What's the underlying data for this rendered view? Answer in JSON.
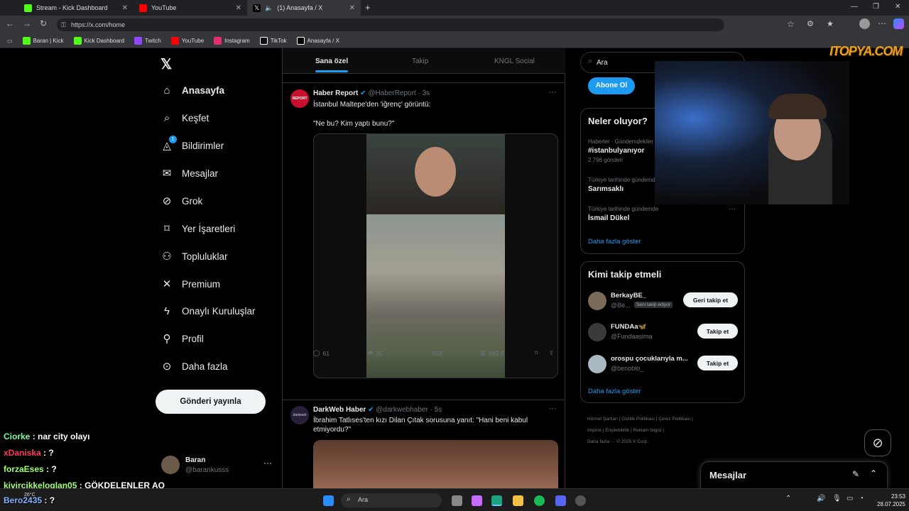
{
  "browser": {
    "tabs": [
      {
        "label": "Stream - Kick Dashboard",
        "color": "#53fc18"
      },
      {
        "label": "YouTube",
        "color": "#ff0000"
      },
      {
        "label": "(1) Anasayfa / X",
        "color": "#ffffff"
      }
    ],
    "url": "https://x.com/home",
    "bookmarks": [
      {
        "label": "Baran | Kick",
        "color": "#53fc18"
      },
      {
        "label": "Kick Dashboard",
        "color": "#53fc18"
      },
      {
        "label": "Twitch",
        "color": "#9146ff"
      },
      {
        "label": "YouTube",
        "color": "#ff0000"
      },
      {
        "label": "Instagram",
        "color": "#e1306c"
      },
      {
        "label": "TikTok",
        "color": "#ffffff"
      },
      {
        "label": "Anasayfa / X",
        "color": "#ffffff"
      }
    ]
  },
  "sidebar": {
    "items": [
      {
        "label": "Anasayfa",
        "icon": "home-icon",
        "glyph": "⌂"
      },
      {
        "label": "Keşfet",
        "icon": "search-icon",
        "glyph": "⌕"
      },
      {
        "label": "Bildirimler",
        "icon": "bell-icon",
        "glyph": "🔔"
      },
      {
        "label": "Mesajlar",
        "icon": "mail-icon",
        "glyph": "✉"
      },
      {
        "label": "Grok",
        "icon": "grok-icon",
        "glyph": "⊘"
      },
      {
        "label": "Yer İşaretleri",
        "icon": "bookmark-icon",
        "glyph": "⌑"
      },
      {
        "label": "Topluluklar",
        "icon": "communities-icon",
        "glyph": "⚇"
      },
      {
        "label": "Premium",
        "icon": "x-logo-icon",
        "glyph": "✕"
      },
      {
        "label": "Onaylı Kuruluşlar",
        "icon": "lightning-icon",
        "glyph": "ϟ"
      },
      {
        "label": "Profil",
        "icon": "person-icon",
        "glyph": "⚲"
      },
      {
        "label": "Daha fazla",
        "icon": "more-circle-icon",
        "glyph": "⋯"
      }
    ],
    "notification_count": "1",
    "post_button": "Gönderi yayınla",
    "account": {
      "name": "Baran",
      "handle": "@barankusss"
    }
  },
  "feed": {
    "tabs": [
      "Sana özel",
      "Takip",
      "KNGL Social"
    ],
    "posts": [
      {
        "name": "Haber Report",
        "handle": "@HaberReport",
        "time": "· 3s",
        "avatar_text": "REPORT",
        "text1": "İstanbul Maltepe'den 'iğrenç' görüntü:",
        "text2": "\"Ne bu? Kim yaptı bunu?\"",
        "actions": {
          "replies": "61",
          "reposts": "35",
          "likes": "658",
          "views": "893 B"
        }
      },
      {
        "name": "DarkWeb Haber",
        "handle": "@darkwebhaber",
        "time": "· 5s",
        "avatar_text": "darkweb",
        "text1": "İbrahim Tatlıses'ten kızı Dilan Çıtak sorusuna yanıt: \"Hani beni kabul etmiyordu?\""
      }
    ]
  },
  "right": {
    "search_placeholder": "Ara",
    "subscribe_button": "Abone Ol",
    "trends": {
      "title": "Neler oluyor?",
      "items": [
        {
          "context": "Haberler · Gündemdekiler",
          "name": "#istanbulyanıyor",
          "count": "2.796 gönderi"
        },
        {
          "context": "Türkiye tarihinde gündemde",
          "name": "Sarımsaklı",
          "count": ""
        },
        {
          "context": "Türkiye tarihinde gündemde",
          "name": "İsmail Dükel",
          "count": ""
        }
      ],
      "show_more": "Daha fazla göster"
    },
    "who_to_follow": {
      "title": "Kimi takip etmeli",
      "users": [
        {
          "name": "BerkayBE_",
          "handle": "@Be...",
          "badge": "Seni takip ediyor",
          "button": "Geri takip et"
        },
        {
          "name": "FUNDAa🦋",
          "handle": "@Fundaasima",
          "badge": "",
          "button": "Takip et"
        },
        {
          "name": "orospu çocuklarıyla m...",
          "handle": "@benoblo_",
          "badge": "",
          "button": "Takip et"
        }
      ],
      "show_more": "Daha fazla göster"
    },
    "footer": [
      "Hizmet Şartları",
      "Gizlilik Politikası",
      "Çerez Politikası",
      "Imprint",
      "Erişilebilirlik",
      "Reklam bilgisi",
      "Daha fazla ···",
      "© 2025 X Corp."
    ],
    "messages_label": "Mesajlar"
  },
  "overlay": {
    "watermark": "ITOPYA.COM",
    "chat": [
      {
        "user": "Ciorke",
        "msg": ": nar city olayı",
        "color": "#7fffa0"
      },
      {
        "user": "xDaniska",
        "msg": ": ?",
        "color": "#ff3b5c"
      },
      {
        "user": "forzaEses",
        "msg": ": ?",
        "color": "#9cff6a"
      },
      {
        "user": "kivircikkeloglan05",
        "msg": ": GÖKDELENLER AQ",
        "color": "#a6ff7a"
      },
      {
        "user": "Bero2435",
        "msg": ": ?",
        "color": "#7fb2ff"
      }
    ]
  },
  "taskbar": {
    "weather": "26°C",
    "search": "Ara",
    "time": "23:53",
    "date": "28.07.2025"
  }
}
